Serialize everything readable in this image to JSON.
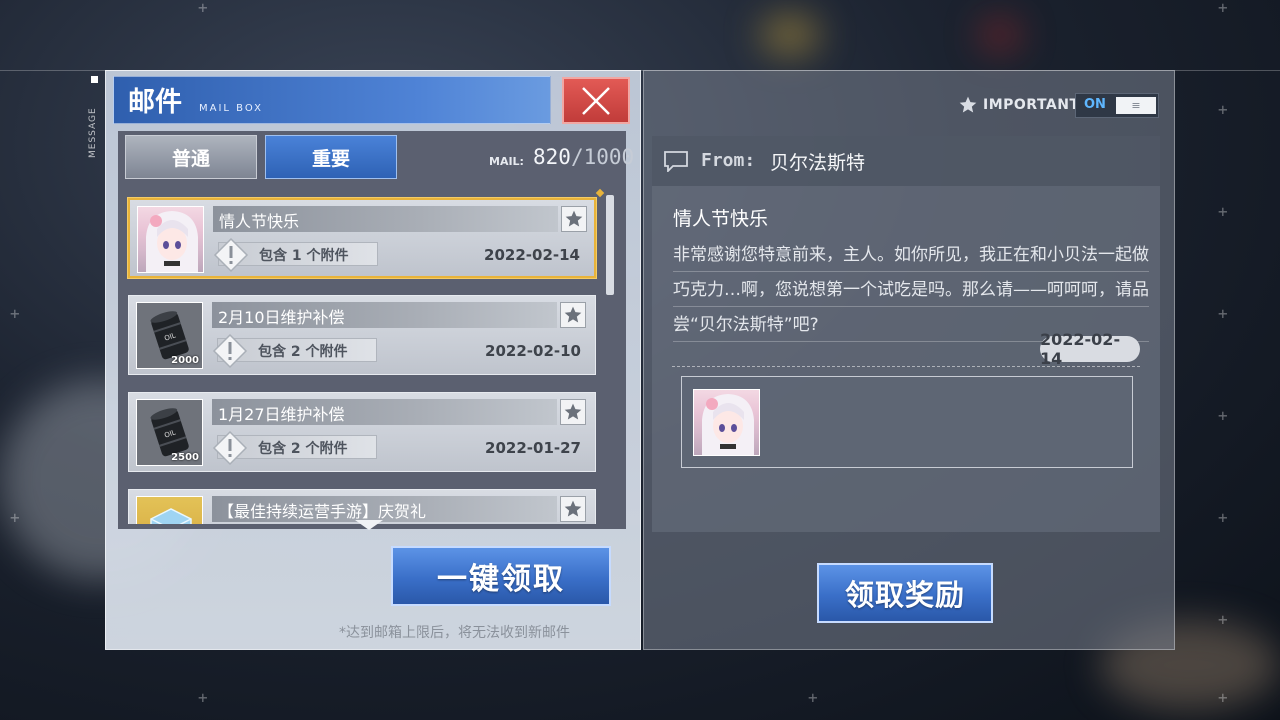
{
  "side_label": "MESSAGE",
  "header": {
    "title": "邮件",
    "subtitle": "MAIL BOX"
  },
  "tabs": [
    {
      "label": "普通",
      "active": false
    },
    {
      "label": "重要",
      "active": true
    }
  ],
  "mail_count": {
    "label": "MAIL:",
    "current": "820",
    "total": "/1000"
  },
  "mails": [
    {
      "title": "情人节快乐",
      "attachment": "包含 1 个附件",
      "date": "2022-02-14",
      "thumb": "anime-portrait",
      "selected": true
    },
    {
      "title": "2月10日维护补偿",
      "attachment": "包含 2 个附件",
      "date": "2022-02-10",
      "thumb": "oil-barrel",
      "amount": "2000",
      "selected": false
    },
    {
      "title": "1月27日维护补偿",
      "attachment": "包含 2 个附件",
      "date": "2022-01-27",
      "thumb": "oil-barrel",
      "amount": "2500",
      "selected": false
    },
    {
      "title": "【最佳持续运营手游】庆贺礼",
      "thumb": "ice-cube",
      "selected": false
    }
  ],
  "claim_all_label": "一键领取",
  "footer_note": "*达到邮箱上限后，将无法收到新邮件",
  "important_filter": {
    "label": "IMPORTANT",
    "state": "ON",
    "knob": "≡"
  },
  "detail": {
    "from_label": "From:",
    "from_name": "贝尔法斯特",
    "title": "情人节快乐",
    "body": "非常感谢您特意前来，主人。如你所见，我正在和小贝法一起做巧克力…啊，您说想第一个试吃是吗。那么请——呵呵呵，请品尝“贝尔法斯特”吧?",
    "date": "2022-02-14",
    "attachment_thumb": "anime-portrait"
  },
  "claim_label": "领取奖励",
  "colors": {
    "accent_blue": "#3a6fc8",
    "close_red": "#d24a47",
    "selected_border": "#e8b33a"
  }
}
